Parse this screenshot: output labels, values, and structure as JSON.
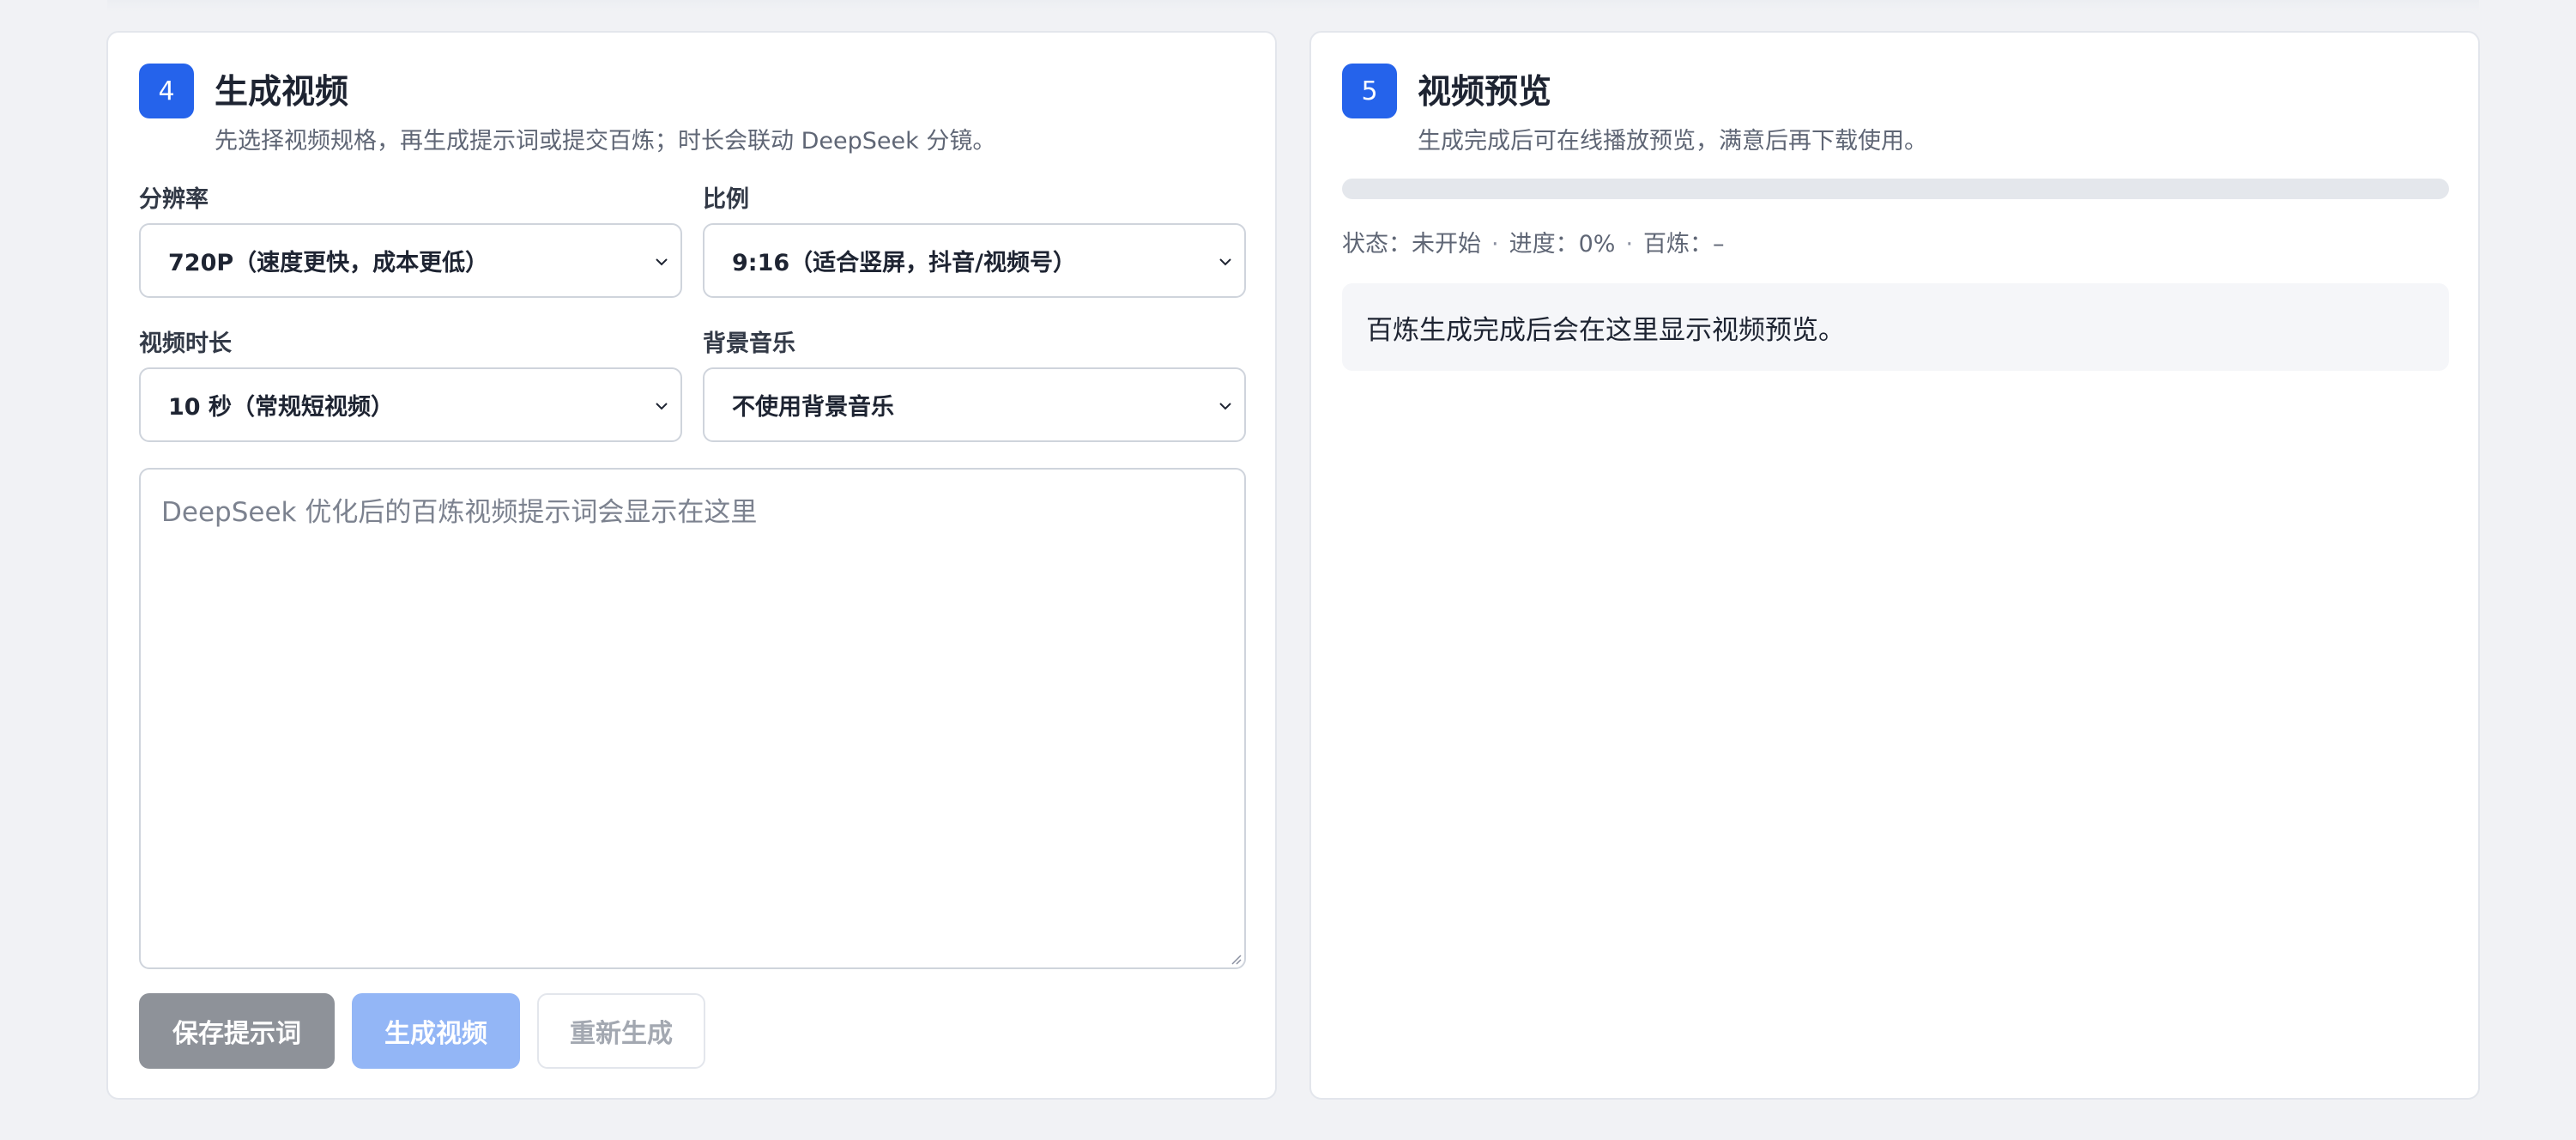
{
  "generate_card": {
    "step": "4",
    "title": "生成视频",
    "subtitle": "先选择视频规格，再生成提示词或提交百炼；时长会联动 DeepSeek 分镜。",
    "resolution": {
      "label": "分辨率",
      "value": "720P（速度更快，成本更低）"
    },
    "ratio": {
      "label": "比例",
      "value": "9:16（适合竖屏，抖音/视频号）"
    },
    "duration": {
      "label": "视频时长",
      "value": "10 秒（常规短视频）"
    },
    "music": {
      "label": "背景音乐",
      "value": "不使用背景音乐"
    },
    "prompt": {
      "value": "",
      "placeholder": "DeepSeek 优化后的百炼视频提示词会显示在这里"
    },
    "buttons": {
      "save": "保存提示词",
      "generate": "生成视频",
      "regenerate": "重新生成"
    }
  },
  "preview_card": {
    "step": "5",
    "title": "视频预览",
    "subtitle": "生成完成后可在线播放预览，满意后再下载使用。",
    "progress_percent": 0,
    "status": {
      "state_text": "状态：未开始",
      "progress_text": "进度：0%",
      "bailian_text": "百炼：–",
      "separator": "·"
    },
    "preview_message": "百炼生成完成后会在这里显示视频预览。"
  },
  "colors": {
    "accent": "#2563eb",
    "accent_disabled": "#93b6f6",
    "button_gray": "#8e9299",
    "page_background": "#f1f2f5"
  },
  "icons": {
    "select_arrow": "chevron-down-icon",
    "textarea_resize": "resize-grip-icon"
  }
}
